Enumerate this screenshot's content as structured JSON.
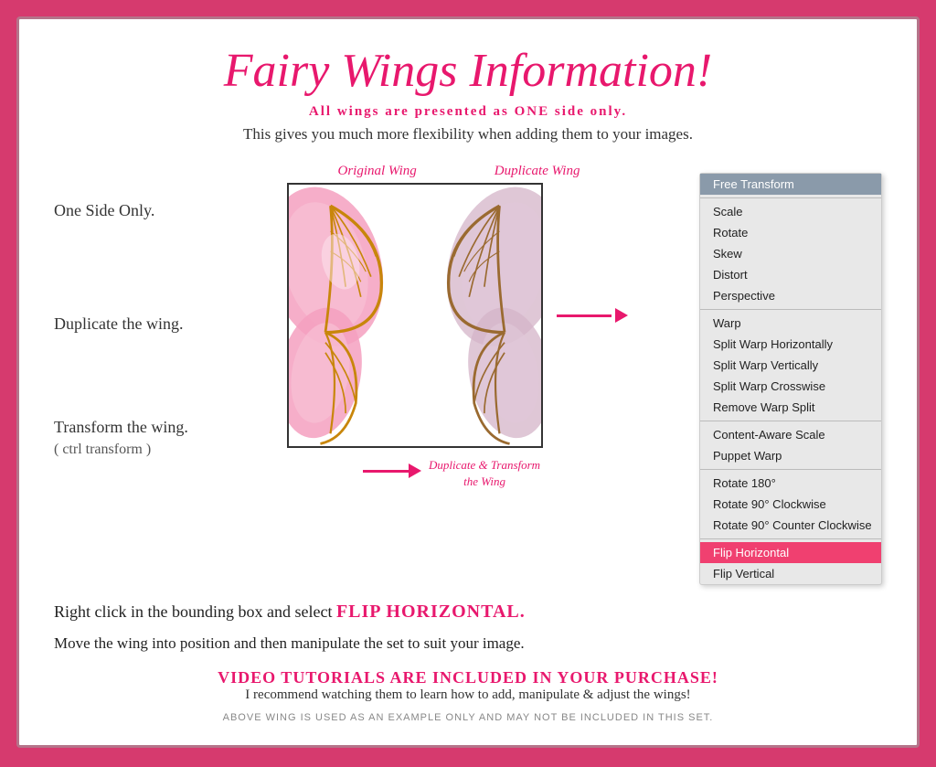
{
  "title": "Fairy Wings Information!",
  "subtitle": {
    "prefix": "All wings are presented as ",
    "bold": "ONE",
    "suffix": " side only."
  },
  "description": "This gives you much more flexibility when adding them to your images.",
  "labels": {
    "one_side": "One Side Only.",
    "duplicate": "Duplicate the wing.",
    "transform": "Transform the wing.",
    "ctrl_transform": "( ctrl transform )",
    "original_wing": "Original Wing",
    "duplicate_wing": "Duplicate Wing",
    "transform_label": "Duplicate & Transform\nthe Wing"
  },
  "flip_instruction": {
    "prefix": "Right click in the bounding box and select ",
    "highlight": "FLIP HORIZONTAL."
  },
  "move_instruction": "Move the wing into position and then manipulate the set to suit your image.",
  "video_banner": {
    "title": "VIDEO TUTORIALS ARE INCLUDED IN YOUR PURCHASE!",
    "subtitle": "I recommend watching them to learn how to add, manipulate & adjust the wings!"
  },
  "footer": "ABOVE WING IS USED AS AN EXAMPLE ONLY AND MAY NOT BE INCLUDED IN THIS SET.",
  "context_menu": {
    "items": [
      {
        "label": "Free Transform",
        "type": "highlighted"
      },
      {
        "label": "",
        "type": "divider"
      },
      {
        "label": "Scale",
        "type": "normal"
      },
      {
        "label": "Rotate",
        "type": "normal"
      },
      {
        "label": "Skew",
        "type": "normal"
      },
      {
        "label": "Distort",
        "type": "normal"
      },
      {
        "label": "Perspective",
        "type": "normal"
      },
      {
        "label": "",
        "type": "divider"
      },
      {
        "label": "Warp",
        "type": "normal"
      },
      {
        "label": "Split Warp Horizontally",
        "type": "normal"
      },
      {
        "label": "Split Warp Vertically",
        "type": "normal"
      },
      {
        "label": "Split Warp Crosswise",
        "type": "normal"
      },
      {
        "label": "Remove Warp Split",
        "type": "normal"
      },
      {
        "label": "",
        "type": "divider"
      },
      {
        "label": "Content-Aware Scale",
        "type": "normal"
      },
      {
        "label": "Puppet Warp",
        "type": "normal"
      },
      {
        "label": "",
        "type": "divider"
      },
      {
        "label": "Rotate 180°",
        "type": "normal"
      },
      {
        "label": "Rotate 90° Clockwise",
        "type": "normal"
      },
      {
        "label": "Rotate 90° Counter Clockwise",
        "type": "normal"
      },
      {
        "label": "",
        "type": "divider"
      },
      {
        "label": "Flip Horizontal",
        "type": "highlighted-pink"
      },
      {
        "label": "Flip Vertical",
        "type": "normal"
      }
    ]
  }
}
